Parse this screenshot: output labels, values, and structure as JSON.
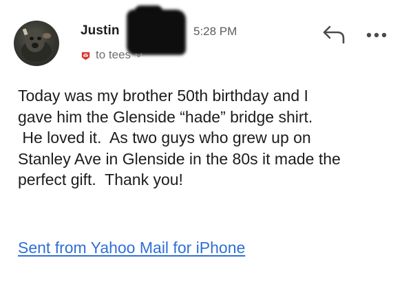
{
  "header": {
    "sender_name": "Justin",
    "time": "5:28 PM",
    "recipient_line": "to tees",
    "icons": {
      "reply": "reply-arrow-icon",
      "more": "more-dots-icon",
      "tag": "mail-tag-icon",
      "chevron": "chevron-down-icon"
    }
  },
  "message": {
    "lines": [
      "Today was my brother 50th birthday and I",
      "gave him the Glenside “hade” bridge shirt.",
      " He loved it.  As two guys who grew up on",
      "Stanley Ave in Glenside in the 80s it made the",
      "perfect gift.  Thank you!"
    ],
    "signature": "Sent from Yahoo Mail for iPhone"
  },
  "colors": {
    "link": "#2f6fd6",
    "tag_red": "#d9342b",
    "text": "#1c1c1e",
    "muted": "#6e6e73"
  }
}
